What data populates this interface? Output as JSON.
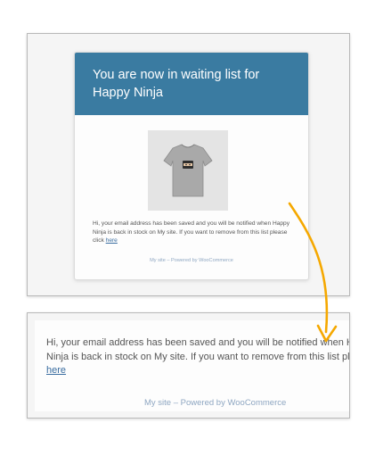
{
  "email": {
    "header_title": "You are now in waiting list for Happy Ninja",
    "body_text": "Hi, your email address has been saved and you will be notified when Happy Ninja is back in stock on My site. If you want to remove from this list please click ",
    "remove_link": "here",
    "footer": "My site – Powered by WooCommerce",
    "header_color": "#3a7ba1"
  },
  "zoom": {
    "line1": "Hi, your email address has been saved and you will be notified when Happy",
    "line2": "Ninja is back in stock on My site. If you want to remove from this list please click",
    "link": "here",
    "footer": "My site – Powered by WooCommerce"
  },
  "arrow": {
    "icon": "curved-arrow-icon",
    "color": "#f5a800"
  }
}
